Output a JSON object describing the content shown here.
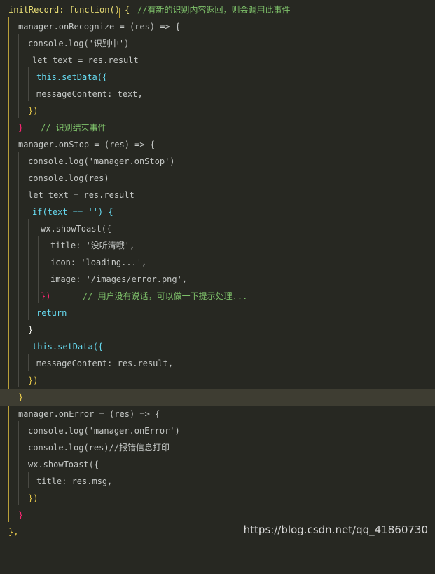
{
  "watermark": "https://blog.csdn.net/qq_41860730",
  "lines": [
    [
      "initRecord: function() {",
      "//有新的识别内容返回，则会调用此事件"
    ],
    [
      "manager.onRecognize = (res) => {"
    ],
    [
      "console.log('识别中')"
    ],
    [
      "let text = res.result"
    ],
    [
      "this.setData({"
    ],
    [
      "messageContent: text,"
    ],
    [
      "})"
    ],
    [
      "}",
      "// 识别结束事件"
    ],
    [
      "manager.onStop = (res) => {"
    ],
    [
      "console.log('manager.onStop')"
    ],
    [
      "console.log(res)"
    ],
    [
      "let text = res.result"
    ],
    [
      "if(text == '') {"
    ],
    [
      "wx.showToast({"
    ],
    [
      "title: '没听清哦',"
    ],
    [
      "icon: 'loading...',"
    ],
    [
      "image: '/images/error.png',"
    ],
    [
      "})",
      "// 用户没有说话，可以做一下提示处理..."
    ],
    [
      "return"
    ],
    [
      "}"
    ],
    [
      "this.setData({"
    ],
    [
      "messageContent: res.result,"
    ],
    [
      "})"
    ],
    [
      "}"
    ],
    [
      "manager.onError = (res) => {"
    ],
    [
      "console.log('manager.onError')"
    ],
    [
      "console.log(res)//报错信息打印"
    ],
    [
      "wx.showToast({"
    ],
    [
      "title: res.msg,"
    ],
    [
      "})"
    ],
    [
      "}"
    ],
    [
      "},"
    ]
  ]
}
